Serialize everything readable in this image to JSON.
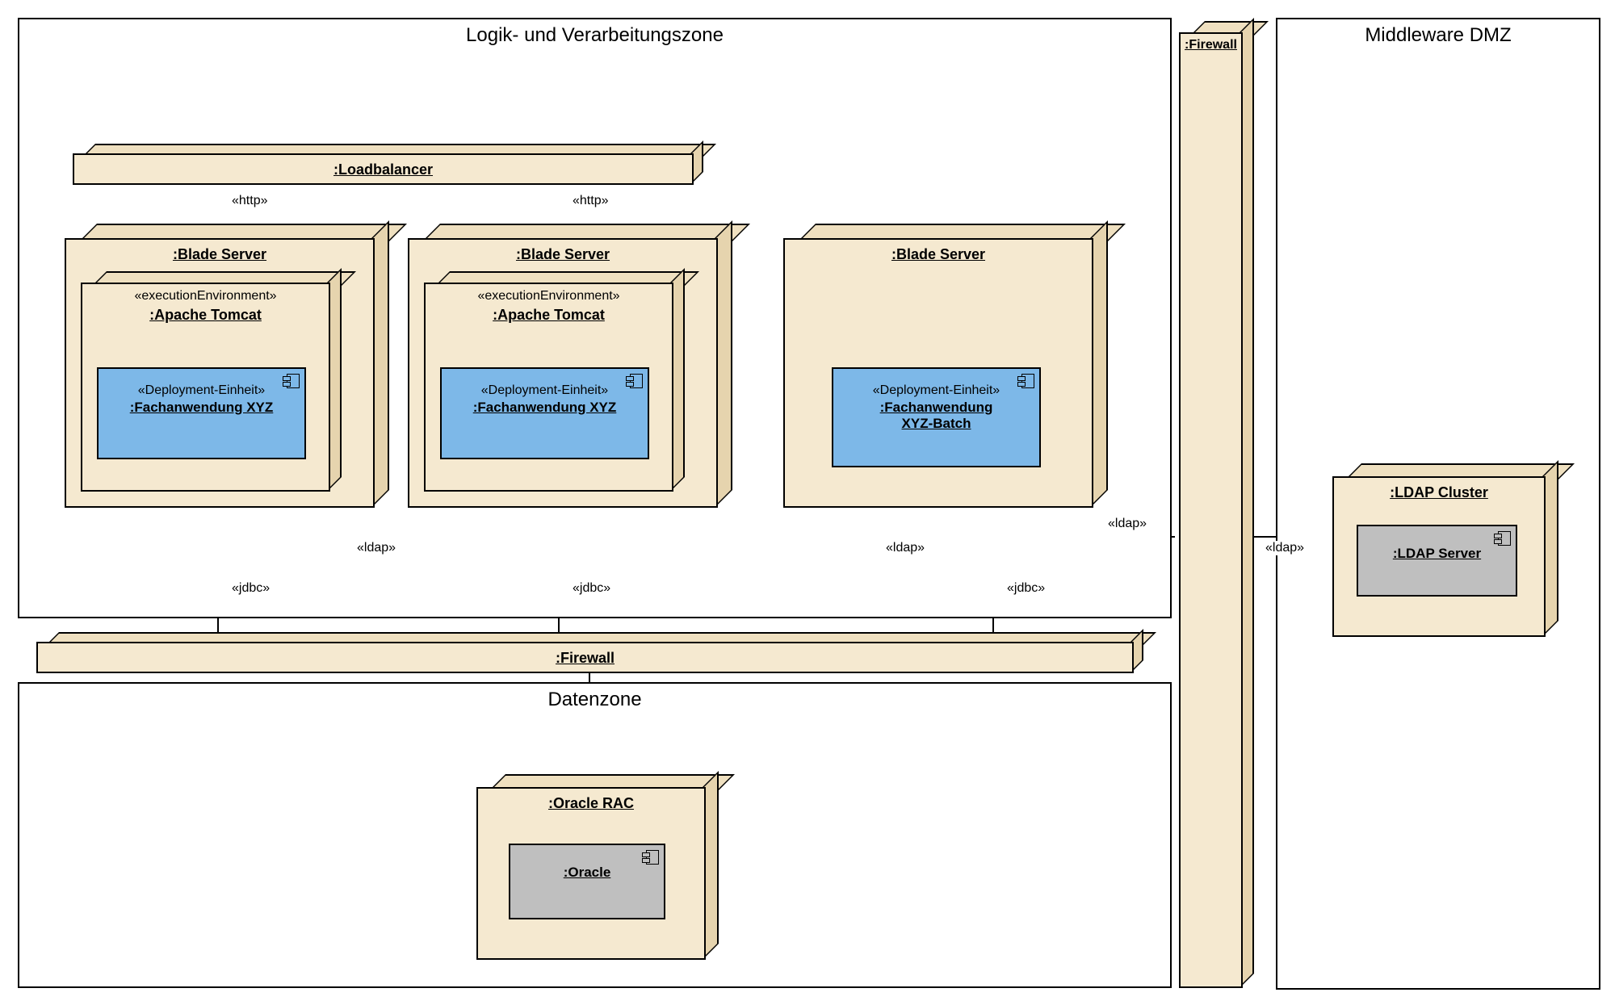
{
  "zones": {
    "logic": {
      "title": "Logik- und Verarbeitungszone"
    },
    "data": {
      "title": "Datenzone"
    },
    "dmz": {
      "title": "Middleware DMZ"
    }
  },
  "nodes": {
    "loadbalancer": {
      "title": ":Loadbalancer"
    },
    "blade1": {
      "title": ":Blade Server"
    },
    "blade2": {
      "title": ":Blade Server"
    },
    "blade3": {
      "title": ":Blade Server"
    },
    "tomcat1": {
      "stereo": "«executionEnvironment»",
      "title": ":Apache Tomcat"
    },
    "tomcat2": {
      "stereo": "«executionEnvironment»",
      "title": ":Apache Tomcat"
    },
    "firewallH": {
      "title": ":Firewall"
    },
    "firewallV": {
      "title": ":Firewall"
    },
    "oracleRac": {
      "title": ":Oracle RAC"
    },
    "ldapCluster": {
      "title": ":LDAP Cluster"
    }
  },
  "components": {
    "fach1": {
      "stereo": "«Deployment-Einheit»",
      "title": ":Fachanwendung XYZ"
    },
    "fach2": {
      "stereo": "«Deployment-Einheit»",
      "title": ":Fachanwendung XYZ"
    },
    "fachBatch": {
      "stereo": "«Deployment-Einheit»",
      "title1": ":Fachanwendung",
      "title2": "XYZ-Batch"
    },
    "oracle": {
      "title": ":Oracle"
    },
    "ldapServer": {
      "title": ":LDAP Server"
    }
  },
  "labels": {
    "http": "«http»",
    "ldap": "«ldap»",
    "jdbc": "«jdbc»"
  }
}
